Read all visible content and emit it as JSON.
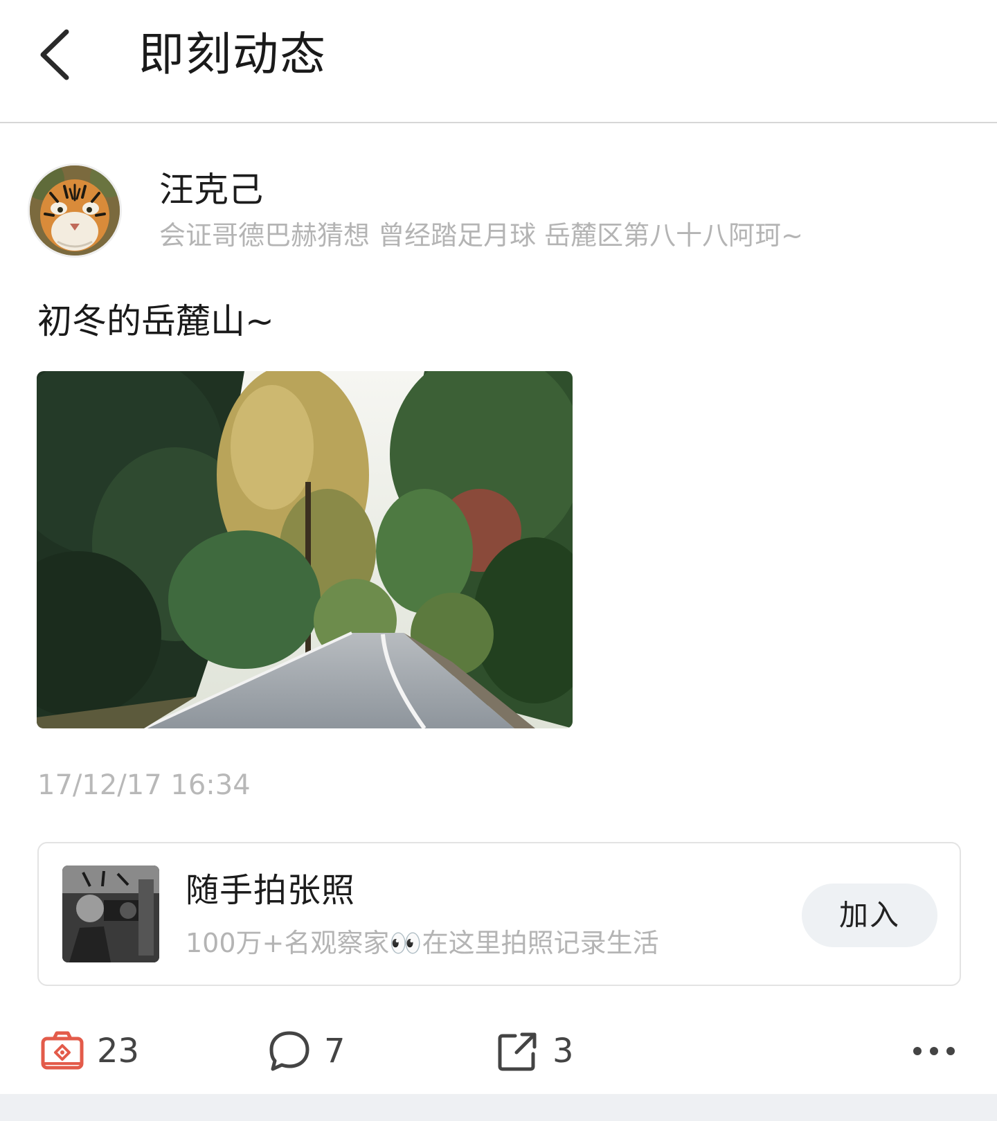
{
  "header": {
    "title": "即刻动态",
    "back_icon": "chevron-left-icon"
  },
  "author": {
    "name": "汪克己",
    "bio": "会证哥德巴赫猜想  曾经踏足月球  岳麓区第八十八阿珂~",
    "avatar": "tiger-avatar"
  },
  "post": {
    "text": "初冬的岳麓山~",
    "photo": "forest-road-photo",
    "timestamp": "17/12/17 16:34"
  },
  "group": {
    "name": "随手拍张照",
    "description": "100万+名观察家👀在这里拍照记录生活",
    "join_label": "加入"
  },
  "actions": {
    "photo_count": "23",
    "comment_count": "7",
    "share_count": "3",
    "icons": [
      "camera-icon",
      "comment-icon",
      "share-icon",
      "more-icon"
    ],
    "accent_color": "#e35b4a"
  }
}
